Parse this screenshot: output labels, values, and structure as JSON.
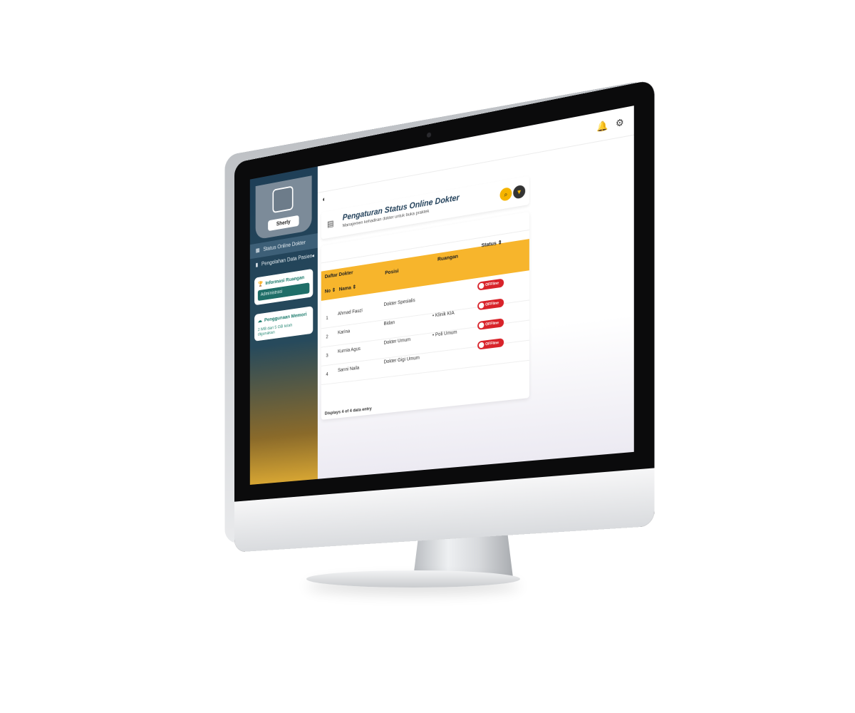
{
  "topbar": {
    "icons": [
      "bell-icon",
      "settings-icon"
    ]
  },
  "sidebar": {
    "profile": {
      "name": "Sherly"
    },
    "items": [
      {
        "label": "Status Online Dokter",
        "icon": "grid-icon",
        "active": true
      },
      {
        "label": "Pengolahan Data Pasien",
        "icon": "file-icon",
        "active": false
      }
    ],
    "room_card": {
      "title": "Informasi Ruangan",
      "value": "Administrasi"
    },
    "memory_card": {
      "title": "Penggunaan Memori",
      "value": "2 MB dari 5 GB telah digunakan"
    }
  },
  "header": {
    "title": "Pengaturan Status Online Dokter",
    "subtitle": "Manajemen kehadiran dokter untuk buka praktek"
  },
  "table": {
    "label": "Daftar Dokter",
    "columns": {
      "no": "No ⇕",
      "nama": "Nama ⇕",
      "posisi": "Posisi",
      "ruangan": "Ruangan",
      "status": "Status ⇕"
    },
    "rows": [
      {
        "no": "1",
        "nama": "Ahmad Fauzi",
        "posisi": "Dokter Spesialis",
        "ruangan": "",
        "status": "OFFline"
      },
      {
        "no": "2",
        "nama": "Karina",
        "posisi": "Bidan",
        "ruangan": "• Klinik KIA",
        "status": "OFFline"
      },
      {
        "no": "3",
        "nama": "Kurnia Agus",
        "posisi": "Dokter Umum",
        "ruangan": "• Poli Umum",
        "status": "OFFline"
      },
      {
        "no": "4",
        "nama": "Sanni Naila",
        "posisi": "Dokter Gigi Umum",
        "ruangan": "",
        "status": "OFFline"
      }
    ],
    "footer": "Displays 4 of 4 data entry"
  },
  "colors": {
    "accent": "#f7b52c",
    "sidebar": "#1f3f57",
    "status_off": "#d8232a"
  }
}
